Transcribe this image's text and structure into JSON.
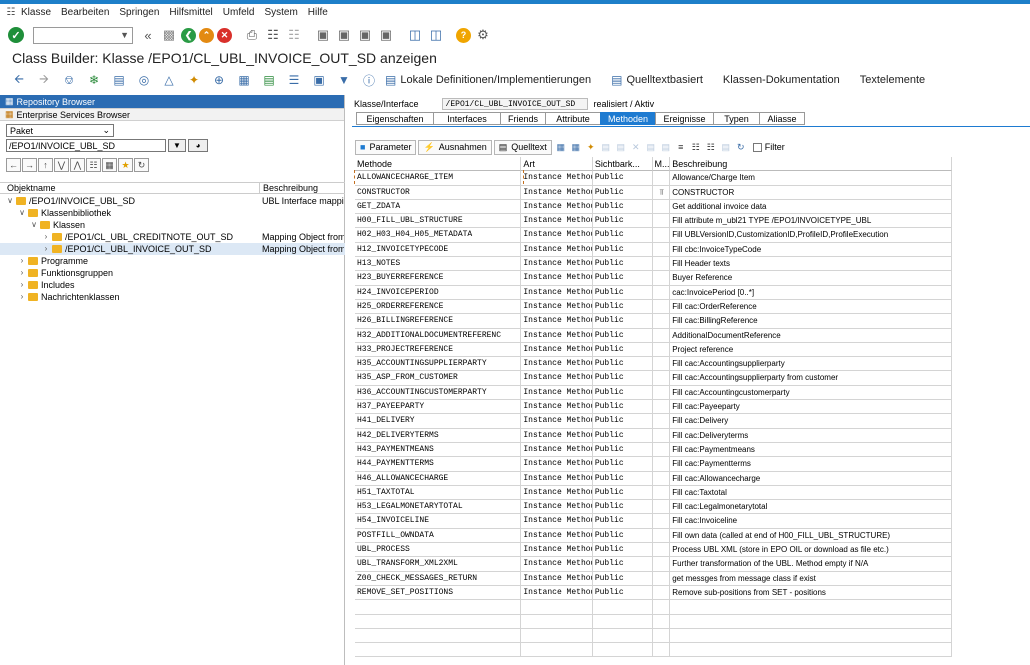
{
  "menu": [
    "Klasse",
    "Bearbeiten",
    "Springen",
    "Hilfsmittel",
    "Umfeld",
    "System",
    "Hilfe"
  ],
  "title": "Class Builder: Klasse /EPO1/CL_UBL_INVOICE_OUT_SD anzeigen",
  "app_toolbar": {
    "lokale": "Lokale Definitionen/Implementierungen",
    "quelltext": "Quelltextbasiert",
    "doku": "Klassen-Dokumentation",
    "textelemente": "Textelemente"
  },
  "left": {
    "repository_browser": "Repository Browser",
    "enterprise_services": "Enterprise Services Browser",
    "select_value": "Paket",
    "package": "/EPO1/INVOICE_UBL_SD",
    "col_objektname": "Objektname",
    "col_beschreibung": "Beschreibung",
    "tree": [
      {
        "label": "/EPO1/INVOICE_UBL_SD",
        "desc": "UBL Interface mapping",
        "depth": 0,
        "exp": "open"
      },
      {
        "label": "Klassenbibliothek",
        "desc": "",
        "depth": 1,
        "exp": "open"
      },
      {
        "label": "Klassen",
        "desc": "",
        "depth": 2,
        "exp": "open"
      },
      {
        "label": "/EPO1/CL_UBL_CREDITNOTE_OUT_SD",
        "desc": "Mapping Object from S",
        "depth": 3,
        "exp": "closed"
      },
      {
        "label": "/EPO1/CL_UBL_INVOICE_OUT_SD",
        "desc": "Mapping Object from S",
        "depth": 3,
        "exp": "closed",
        "selected": true
      },
      {
        "label": "Programme",
        "desc": "",
        "depth": 1,
        "exp": "closed"
      },
      {
        "label": "Funktionsgruppen",
        "desc": "",
        "depth": 1,
        "exp": "closed"
      },
      {
        "label": "Includes",
        "desc": "",
        "depth": 1,
        "exp": "closed"
      },
      {
        "label": "Nachrichtenklassen",
        "desc": "",
        "depth": 1,
        "exp": "closed"
      }
    ]
  },
  "right": {
    "klasse_label": "Klasse/Interface",
    "klasse_value": "/EPO1/CL_UBL_INVOICE_OUT_SD",
    "status": "realisiert / Aktiv",
    "tabs": [
      {
        "label": "Eigenschaften",
        "w": 77
      },
      {
        "label": "Interfaces",
        "w": 67
      },
      {
        "label": "Friends",
        "w": 45
      },
      {
        "label": "Attribute",
        "w": 55
      },
      {
        "label": "Methoden",
        "w": 55,
        "active": true
      },
      {
        "label": "Ereignisse",
        "w": 58
      },
      {
        "label": "Typen",
        "w": 46
      },
      {
        "label": "Aliasse",
        "w": 46
      }
    ],
    "toolbar": {
      "parameter": "Parameter",
      "ausnahmen": "Ausnahmen",
      "quelltext": "Quelltext",
      "filter": "Filter"
    },
    "columns": {
      "methode": "Methode",
      "art": "Art",
      "sicht": "Sichtbark...",
      "m": "M...",
      "beschreibung": "Beschreibung"
    },
    "rows": [
      [
        "ALLOWANCECHARGE_ITEM",
        "Instance Method",
        "Public",
        "",
        "Allowance/Charge Item"
      ],
      [
        "CONSTRUCTOR",
        "Instance Method",
        "Public",
        "ctor",
        "CONSTRUCTOR"
      ],
      [
        "GET_ZDATA",
        "Instance Method",
        "Public",
        "",
        "Get additional invoice data"
      ],
      [
        "H00_FILL_UBL_STRUCTURE",
        "Instance Method",
        "Public",
        "",
        "Fill attribute m_ubl21 TYPE /EPO1/INVOICETYPE_UBL"
      ],
      [
        "H02_H03_H04_H05_METADATA",
        "Instance Method",
        "Public",
        "",
        "Fill UBLVersionID,CustomizationID,ProfileID,ProfileExecution"
      ],
      [
        "H12_INVOICETYPECODE",
        "Instance Method",
        "Public",
        "",
        "Fill cbc:InvoiceTypeCode"
      ],
      [
        "H13_NOTES",
        "Instance Method",
        "Public",
        "",
        "Fill Header texts"
      ],
      [
        "H23_BUYERREFERENCE",
        "Instance Method",
        "Public",
        "",
        "Buyer Reference"
      ],
      [
        "H24_INVOICEPERIOD",
        "Instance Method",
        "Public",
        "",
        "cac:InvoicePeriod [0..*]"
      ],
      [
        "H25_ORDERREFERENCE",
        "Instance Method",
        "Public",
        "",
        "Fill cac:OrderReference"
      ],
      [
        "H26_BILLINGREFERENCE",
        "Instance Method",
        "Public",
        "",
        "Fill cac:BillingReference"
      ],
      [
        "H32_ADDITIONALDOCUMENTREFERENC",
        "Instance Method",
        "Public",
        "",
        "AdditionalDocumentReference"
      ],
      [
        "H33_PROJECTREFERENCE",
        "Instance Method",
        "Public",
        "",
        "Project reference"
      ],
      [
        "H35_ACCOUNTINGSUPPLIERPARTY",
        "Instance Method",
        "Public",
        "",
        "Fill cac:Accountingsupplierparty"
      ],
      [
        "H35_ASP_FROM_CUSTOMER",
        "Instance Method",
        "Public",
        "",
        "Fill cac:Accountingsupplierparty from customer"
      ],
      [
        "H36_ACCOUNTINGCUSTOMERPARTY",
        "Instance Method",
        "Public",
        "",
        "Fill cac:Accountingcustomerparty"
      ],
      [
        "H37_PAYEEPARTY",
        "Instance Method",
        "Public",
        "",
        "Fill cac:Payeeparty"
      ],
      [
        "H41_DELIVERY",
        "Instance Method",
        "Public",
        "",
        "Fill cac:Delivery"
      ],
      [
        "H42_DELIVERYTERMS",
        "Instance Method",
        "Public",
        "",
        "Fill cac:Deliveryterms"
      ],
      [
        "H43_PAYMENTMEANS",
        "Instance Method",
        "Public",
        "",
        "Fill cac:Paymentmeans"
      ],
      [
        "H44_PAYMENTTERMS",
        "Instance Method",
        "Public",
        "",
        "Fill cac:Paymentterms"
      ],
      [
        "H46_ALLOWANCECHARGE",
        "Instance Method",
        "Public",
        "",
        "Fill cac:Allowancecharge"
      ],
      [
        "H51_TAXTOTAL",
        "Instance Method",
        "Public",
        "",
        "Fill cac:Taxtotal"
      ],
      [
        "H53_LEGALMONETARYTOTAL",
        "Instance Method",
        "Public",
        "",
        "Fill cac:Legalmonetarytotal"
      ],
      [
        "H54_INVOICELINE",
        "Instance Method",
        "Public",
        "",
        "Fill cac:Invoiceline"
      ],
      [
        "POSTFILL_OWNDATA",
        "Instance Method",
        "Public",
        "",
        "Fill own data (called at end of H00_FILL_UBL_STRUCTURE)"
      ],
      [
        "UBL_PROCESS",
        "Instance Method",
        "Public",
        "",
        "Process UBL XML (store in EPO OIL or download as file etc.)"
      ],
      [
        "UBL_TRANSFORM_XML2XML",
        "Instance Method",
        "Public",
        "",
        "Further transformation of the UBL. Method empty if N/A"
      ],
      [
        "Z00_CHECK_MESSAGES_RETURN",
        "Instance Method",
        "Public",
        "",
        "get messges from message class if exist"
      ],
      [
        "REMOVE_SET_POSITIONS",
        "Instance Method",
        "Public",
        "",
        "Remove sub-positions from SET - positions"
      ]
    ]
  }
}
